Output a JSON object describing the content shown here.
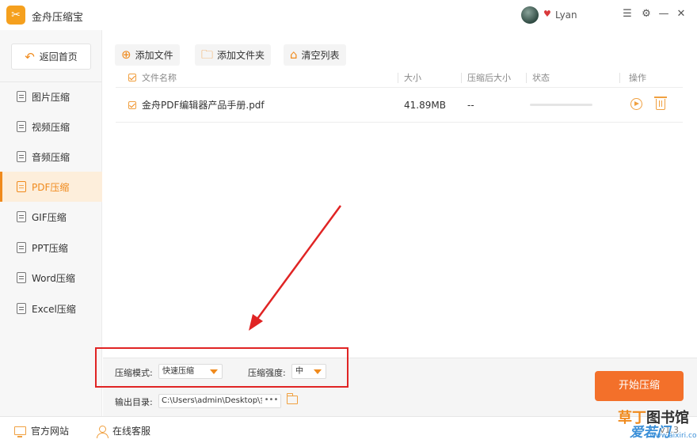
{
  "app": {
    "title": "金舟压缩宝",
    "logo_glyph": "✂",
    "accent": "#f08a1c",
    "start_color": "#f3702a"
  },
  "user": {
    "name": "Lyan"
  },
  "window_controls": {
    "menu": "☰",
    "skin": "⚙",
    "minimize": "—",
    "maximize": "☐",
    "close": "✕"
  },
  "sidebar": {
    "back_label": "返回首页",
    "items": [
      {
        "label": "图片压缩"
      },
      {
        "label": "视频压缩"
      },
      {
        "label": "音频压缩"
      },
      {
        "label": "PDF压缩",
        "active": true
      },
      {
        "label": "GIF压缩"
      },
      {
        "label": "PPT压缩"
      },
      {
        "label": "Word压缩"
      },
      {
        "label": "Excel压缩"
      }
    ]
  },
  "toolbar": {
    "add_file": "添加文件",
    "add_folder": "添加文件夹",
    "clear_list": "清空列表"
  },
  "table": {
    "headers": {
      "name": "文件名称",
      "size": "大小",
      "compressed_size": "压缩后大小",
      "status": "状态",
      "action": "操作"
    },
    "rows": [
      {
        "name": "金舟PDF编辑器产品手册.pdf",
        "size": "41.89MB",
        "compressed_size": "--",
        "progress": 0
      }
    ]
  },
  "settings": {
    "mode_label": "压缩模式:",
    "mode_value": "快速压缩",
    "strength_label": "压缩强度:",
    "strength_value": "中",
    "output_label": "输出目录:",
    "output_path": "C:\\Users\\admin\\Desktop\\金",
    "more": "•••"
  },
  "start_button": "开始压缩",
  "statusbar": {
    "website": "官方网站",
    "support": "在线客服",
    "version": "v1.3"
  },
  "watermark": {
    "line1_a": "草丁",
    "line1_b": "图书馆",
    "line2": "爱若门",
    "line3": "www.aixiri.com"
  }
}
